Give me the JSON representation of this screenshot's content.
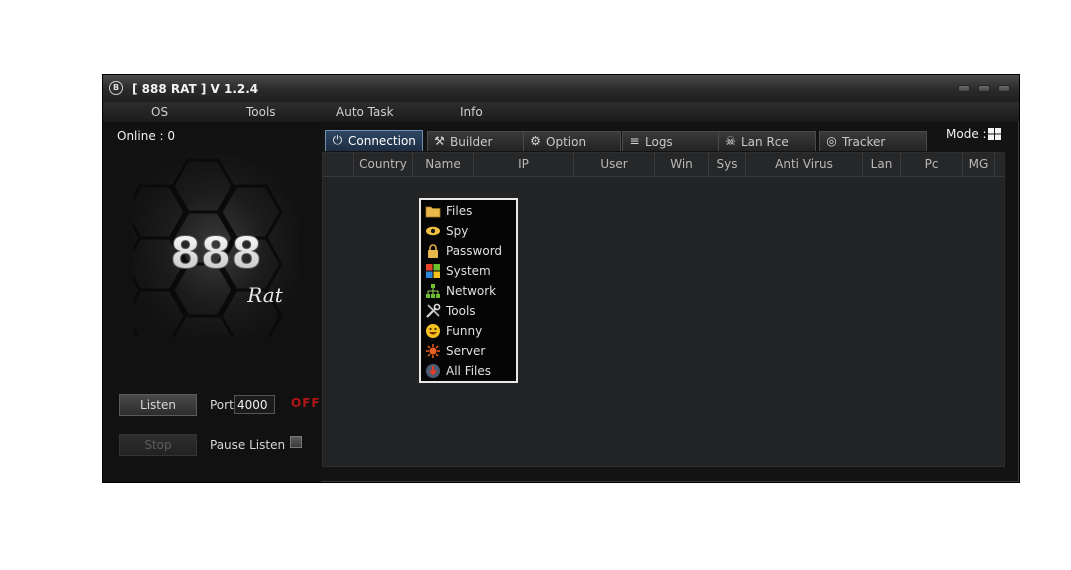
{
  "window": {
    "title": "[  888 RAT  ] V 1.2.4"
  },
  "menu": [
    "OS",
    "Tools",
    "Auto Task",
    "Info"
  ],
  "left_panel": {
    "online_text": "Online : 0",
    "logo_number": "888",
    "logo_text": "Rat",
    "listen_label": "Listen",
    "stop_label": "Stop",
    "port_label": "Port",
    "port_value": "4000",
    "status_text": "OFF",
    "pause_label": "Pause Listen",
    "pause_checked": false
  },
  "mode_label": "Mode :",
  "tabs": [
    {
      "label": "Connection",
      "icon": "plug-icon",
      "active": true
    },
    {
      "label": "Builder",
      "icon": "tools-icon",
      "active": false
    },
    {
      "label": "Option",
      "icon": "gear-icon",
      "active": false
    },
    {
      "label": "Logs",
      "icon": "database-icon",
      "active": false
    },
    {
      "label": "Lan Rce",
      "icon": "skull-icon",
      "active": false
    },
    {
      "label": "Tracker",
      "icon": "globe-icon",
      "active": false
    }
  ],
  "columns": [
    "Country",
    "Name",
    "IP",
    "User",
    "Win",
    "Sys",
    "Anti Virus",
    "Lan",
    "Pc",
    "MG"
  ],
  "context_menu": [
    {
      "label": "Files",
      "icon": "folder-icon"
    },
    {
      "label": "Spy",
      "icon": "eye-icon"
    },
    {
      "label": "Password",
      "icon": "lock-icon"
    },
    {
      "label": "System",
      "icon": "windows-icon"
    },
    {
      "label": "Network",
      "icon": "network-icon"
    },
    {
      "label": "Tools",
      "icon": "tools-icon"
    },
    {
      "label": "Funny",
      "icon": "smiley-icon"
    },
    {
      "label": "Server",
      "icon": "server-icon"
    },
    {
      "label": "All Files",
      "icon": "download-icon"
    }
  ],
  "colors": {
    "status_off": "#b01616",
    "active_tab": "#2f4661",
    "background": "#131313"
  }
}
